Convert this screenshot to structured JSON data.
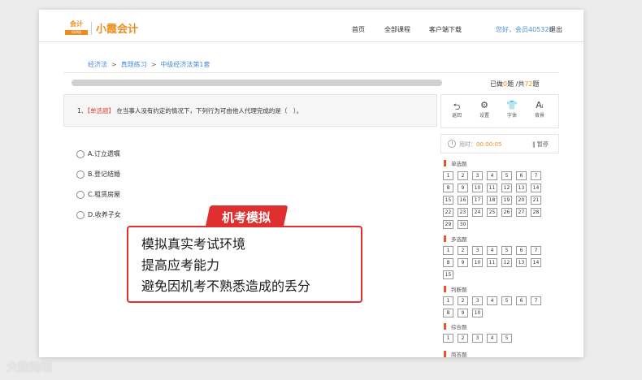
{
  "header": {
    "logo_cn": "会计",
    "logo_en": "KUAIJI",
    "logo_text": "小霞会计",
    "nav": [
      "首页",
      "全部课程",
      "客户端下载"
    ],
    "user_greeting": "您好，会员405328",
    "logout": "退出"
  },
  "breadcrumb": [
    "经济法",
    "真题练习",
    "中级经济法第1套"
  ],
  "progress": {
    "done_prefix": "已做",
    "done": "0",
    "mid": "题 /共",
    "total": "72",
    "suffix": "题",
    "fraction": 0
  },
  "question": {
    "number": "1、",
    "tag": "【单选题】",
    "text": "在当事人没有约定的情况下，下列行为可由他人代理完成的是（　）。",
    "options": [
      "A.订立遗嘱",
      "B.登记结婚",
      "C.租赁房屋",
      "D.收养子女"
    ]
  },
  "tools": [
    {
      "icon": "back-icon",
      "glyph": "⮌",
      "label": "返回"
    },
    {
      "icon": "gear-icon",
      "glyph": "⚙",
      "label": "设置"
    },
    {
      "icon": "shirt-icon",
      "glyph": "👕",
      "label": "字体"
    },
    {
      "icon": "font-size-icon",
      "glyph": "Aᵢ",
      "label": "背景"
    }
  ],
  "timer": {
    "label": "用时：",
    "time": "00:00:05",
    "pause": "‖ 暂停"
  },
  "sections": [
    {
      "title": "单选题",
      "items": [
        "1",
        "2",
        "3",
        "4",
        "5",
        "6",
        "7",
        "8",
        "9",
        "10",
        "11",
        "12",
        "13",
        "14",
        "15",
        "16",
        "17",
        "18",
        "19",
        "20",
        "21",
        "22",
        "23",
        "24",
        "25",
        "26",
        "27",
        "28",
        "29",
        "30"
      ]
    },
    {
      "title": "多选题",
      "items": [
        "1",
        "2",
        "3",
        "4",
        "5",
        "6",
        "7",
        "8",
        "9",
        "10",
        "11",
        "12",
        "13",
        "14",
        "15"
      ]
    },
    {
      "title": "判断题",
      "items": [
        "1",
        "2",
        "3",
        "4",
        "5",
        "6",
        "7",
        "8",
        "9",
        "10"
      ]
    },
    {
      "title": "综合题",
      "items": [
        "1",
        "2",
        "3",
        "4",
        "5"
      ]
    },
    {
      "title": "简答题",
      "items": []
    }
  ],
  "promo": {
    "badge": "机考模拟",
    "lines": [
      "模拟真实考试环境",
      "提高应考能力",
      "避免因机考不熟悉造成的丢分"
    ]
  },
  "watermark": "大数跨境"
}
